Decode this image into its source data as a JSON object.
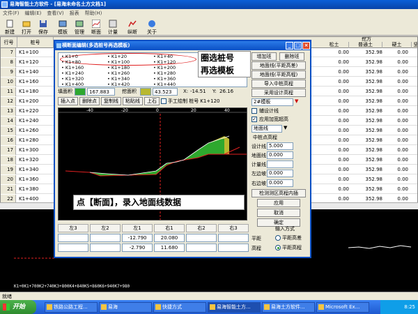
{
  "app": {
    "title": "易海智能土方软件 - [易海未命名土方文档1]",
    "menu": [
      "文件(F)",
      "编辑(E)",
      "查看(V)",
      "报表",
      "帮助(H)"
    ],
    "toolbar": [
      {
        "label": "新建",
        "icon": "new-file-icon"
      },
      {
        "label": "打开",
        "icon": "folder-open-icon"
      },
      {
        "label": "保存",
        "icon": "save-icon"
      },
      {
        "label": "模板",
        "icon": "template-icon"
      },
      {
        "label": "管理",
        "icon": "manage-icon"
      },
      {
        "label": "断面",
        "icon": "cross-section-icon"
      },
      {
        "label": "计量",
        "icon": "measure-icon"
      },
      {
        "label": "纵断",
        "icon": "profile-icon"
      },
      {
        "label": "关于",
        "icon": "about-icon"
      }
    ]
  },
  "grid": {
    "headers": {
      "idx": "行号",
      "stake": "桩号",
      "group": "挖方",
      "c1": "松土",
      "c2": "普通土",
      "c3": "硬土",
      "c4": "坚石"
    },
    "rows": [
      {
        "idx": "7",
        "stake": "K1+100",
        "v1": "0.00",
        "v2": "352.98",
        "v3": "0.00"
      },
      {
        "idx": "8",
        "stake": "K1+120",
        "v1": "0.00",
        "v2": "352.98",
        "v3": "0.00"
      },
      {
        "idx": "9",
        "stake": "K1+140",
        "v1": "0.00",
        "v2": "352.98",
        "v3": "0.00"
      },
      {
        "idx": "10",
        "stake": "K1+160",
        "v1": "0.00",
        "v2": "352.98",
        "v3": "0.00"
      },
      {
        "idx": "11",
        "stake": "K1+180",
        "v1": "0.00",
        "v2": "352.98",
        "v3": "0.00"
      },
      {
        "idx": "12",
        "stake": "K1+200",
        "v1": "0.00",
        "v2": "352.98",
        "v3": "0.00"
      },
      {
        "idx": "13",
        "stake": "K1+220",
        "v1": "0.00",
        "v2": "352.98",
        "v3": "0.00"
      },
      {
        "idx": "14",
        "stake": "K1+240",
        "v1": "0.00",
        "v2": "352.98",
        "v3": "0.00"
      },
      {
        "idx": "15",
        "stake": "K1+260",
        "v1": "0.00",
        "v2": "352.98",
        "v3": "0.00"
      },
      {
        "idx": "16",
        "stake": "K1+280",
        "v1": "0.00",
        "v2": "352.98",
        "v3": "0.00"
      },
      {
        "idx": "17",
        "stake": "K1+300",
        "v1": "0.00",
        "v2": "352.98",
        "v3": "0.00"
      },
      {
        "idx": "18",
        "stake": "K1+320",
        "v1": "0.00",
        "v2": "352.98",
        "v3": "0.00"
      },
      {
        "idx": "19",
        "stake": "K1+340",
        "v1": "0.00",
        "v2": "352.98",
        "v3": "0.00"
      },
      {
        "idx": "20",
        "stake": "K1+360",
        "v1": "0.00",
        "v2": "352.98",
        "v3": "0.00"
      },
      {
        "idx": "21",
        "stake": "K1+380",
        "v1": "0.00",
        "v2": "352.98",
        "v3": "0.00"
      },
      {
        "idx": "22",
        "stake": "K1+400",
        "v1": "0.00",
        "v2": "352.98",
        "v3": "0.00"
      }
    ]
  },
  "cad_text": "K1+0K1+700K2+740K3+800K4+840K5+860K6+940K7+980",
  "statusbar": "就绪",
  "taskbar": {
    "start": "开始",
    "tasks": [
      "铁路公路工程...",
      "易海",
      "快捷方式",
      "易海智能土方...",
      "易海土方软件...",
      "Microsoft Ex..."
    ],
    "clock": "8:25"
  },
  "dialog": {
    "title": "横断面编辑(多选桩号再选模板)",
    "stakes": [
      [
        "K1+0",
        "K1+20",
        "K1+40"
      ],
      [
        "K1+80",
        "K1+100",
        "K1+120"
      ],
      [
        "K1+160",
        "K1+180",
        "K1+200"
      ],
      [
        "K1+240",
        "K1+260",
        "K1+280"
      ],
      [
        "K1+320",
        "K1+340",
        "K1+360"
      ],
      [
        "K1+400",
        "K1+420",
        "K1+440"
      ]
    ],
    "fill_area_label": "填面积",
    "fill_area_value": "167.883",
    "cut_area_label": "挖面积",
    "cut_area_value": "43.523",
    "x_label": "X:",
    "x_value": "-14.51",
    "y_label": "Y:",
    "y_value": "26.16",
    "buttons": [
      "插入点",
      "删除点",
      "复制线",
      "粘贴线",
      "上石"
    ],
    "manual_label": "手工绘制 桩号",
    "manual_stake": "K1+120",
    "callout_top": "圈选桩号\n再选模板",
    "callout_bottom": "点【断面】，录入地面线数据",
    "axis_ticks": [
      "-40",
      "-20",
      "0",
      "20",
      "40"
    ],
    "right": {
      "buttons": [
        "增加班",
        "删除班",
        "地面线(平距高差)",
        "地面线(平距高程)",
        "导入中桩高程",
        "采用设计高程"
      ],
      "template_select": "2#模板",
      "cb_design": "辅设计线",
      "cb_apply": "应用加宽超高",
      "ground_select": "地面线",
      "center_elev": "中桩点高程",
      "design_label": "设计线",
      "design_value": "5.000",
      "ground_label": "地面线",
      "ground_value": "0.000",
      "measure_label": "计量线",
      "left_slope_label": "左边坡",
      "left_slope_value": "0.000",
      "right_slope_label": "右边坡",
      "right_slope_value": "0.000",
      "calc_btn": "检测测区高程内插",
      "apply": "应用",
      "cancel": "取消",
      "ok": "确定"
    },
    "table": {
      "headers": [
        "左3",
        "左2",
        "左1",
        "右1",
        "右2",
        "右3"
      ],
      "row1": [
        "",
        "",
        "-12.790",
        "20.080",
        "",
        ""
      ],
      "row2": [
        "",
        "",
        "-2.790",
        "11.680",
        "",
        ""
      ],
      "side1": "平距",
      "side2": "高程"
    },
    "input_mode_label": "输入方式",
    "mode1": "平距高差",
    "mode2": "平距高程"
  },
  "colors": {
    "fill": "#2ea82e",
    "cut": "#b8b830",
    "design_line": "#e02020",
    "ground": "#ffffff"
  }
}
